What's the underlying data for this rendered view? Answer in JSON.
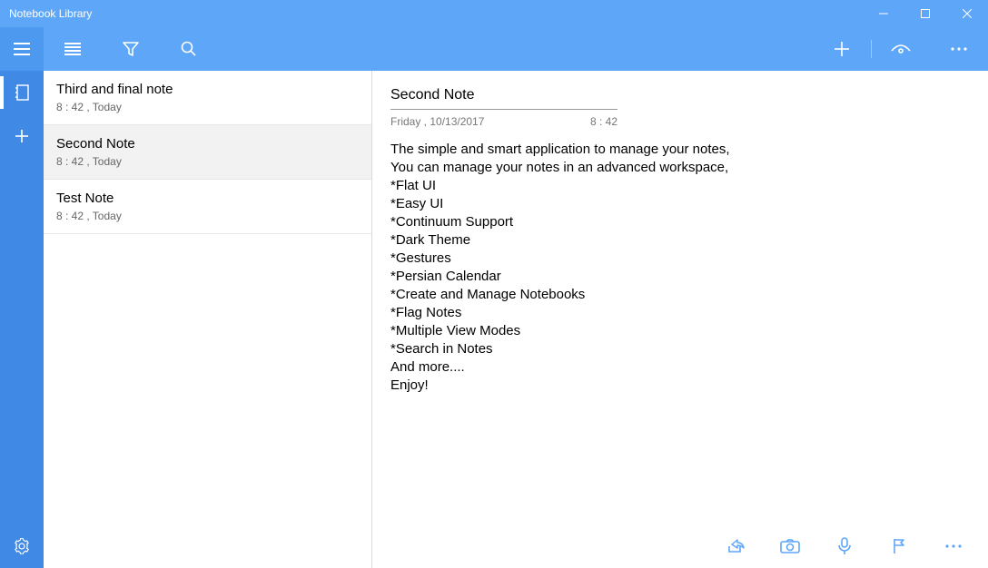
{
  "window": {
    "title": "Notebook Library"
  },
  "notes": [
    {
      "title": "Third and final note",
      "meta": "8 : 42 , Today",
      "selected": false
    },
    {
      "title": "Second Note",
      "meta": "8 : 42 , Today",
      "selected": true
    },
    {
      "title": "Test Note",
      "meta": "8 : 42 , Today",
      "selected": false
    }
  ],
  "detail": {
    "title": "Second Note",
    "date": "Friday , 10/13/2017",
    "time": "8 : 42",
    "body": "The simple and smart application to manage your notes,\nYou can manage your notes in an advanced workspace,\n*Flat UI\n*Easy UI\n*Continuum Support\n*Dark Theme\n*Gestures\n*Persian Calendar\n*Create and Manage Notebooks\n*Flag Notes\n*Multiple View Modes\n*Search in Notes\nAnd more....\nEnjoy!"
  }
}
